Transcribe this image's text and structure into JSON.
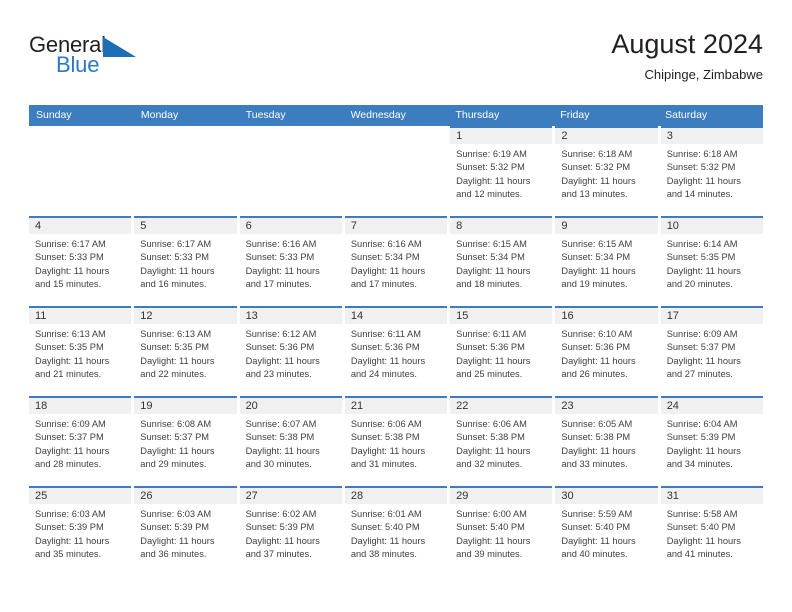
{
  "brand": {
    "line1": "General",
    "line2": "Blue",
    "flag_icon": "triangle-flag-icon",
    "color_dark": "#231f20",
    "color_blue": "#2b7ac4"
  },
  "header": {
    "title": "August 2024",
    "subtitle": "Chipinge, Zimbabwe"
  },
  "theme": {
    "header_blue": "#3c7dbf",
    "daynum_band": "#f0f0f0",
    "text": "#3f3f3f"
  },
  "calendar": {
    "day_names": [
      "Sunday",
      "Monday",
      "Tuesday",
      "Wednesday",
      "Thursday",
      "Friday",
      "Saturday"
    ],
    "weeks": [
      [
        {
          "day": "",
          "lines": []
        },
        {
          "day": "",
          "lines": []
        },
        {
          "day": "",
          "lines": []
        },
        {
          "day": "",
          "lines": []
        },
        {
          "day": "1",
          "lines": [
            "Sunrise: 6:19 AM",
            "Sunset: 5:32 PM",
            "Daylight: 11 hours",
            "and 12 minutes."
          ]
        },
        {
          "day": "2",
          "lines": [
            "Sunrise: 6:18 AM",
            "Sunset: 5:32 PM",
            "Daylight: 11 hours",
            "and 13 minutes."
          ]
        },
        {
          "day": "3",
          "lines": [
            "Sunrise: 6:18 AM",
            "Sunset: 5:32 PM",
            "Daylight: 11 hours",
            "and 14 minutes."
          ]
        }
      ],
      [
        {
          "day": "4",
          "lines": [
            "Sunrise: 6:17 AM",
            "Sunset: 5:33 PM",
            "Daylight: 11 hours",
            "and 15 minutes."
          ]
        },
        {
          "day": "5",
          "lines": [
            "Sunrise: 6:17 AM",
            "Sunset: 5:33 PM",
            "Daylight: 11 hours",
            "and 16 minutes."
          ]
        },
        {
          "day": "6",
          "lines": [
            "Sunrise: 6:16 AM",
            "Sunset: 5:33 PM",
            "Daylight: 11 hours",
            "and 17 minutes."
          ]
        },
        {
          "day": "7",
          "lines": [
            "Sunrise: 6:16 AM",
            "Sunset: 5:34 PM",
            "Daylight: 11 hours",
            "and 17 minutes."
          ]
        },
        {
          "day": "8",
          "lines": [
            "Sunrise: 6:15 AM",
            "Sunset: 5:34 PM",
            "Daylight: 11 hours",
            "and 18 minutes."
          ]
        },
        {
          "day": "9",
          "lines": [
            "Sunrise: 6:15 AM",
            "Sunset: 5:34 PM",
            "Daylight: 11 hours",
            "and 19 minutes."
          ]
        },
        {
          "day": "10",
          "lines": [
            "Sunrise: 6:14 AM",
            "Sunset: 5:35 PM",
            "Daylight: 11 hours",
            "and 20 minutes."
          ]
        }
      ],
      [
        {
          "day": "11",
          "lines": [
            "Sunrise: 6:13 AM",
            "Sunset: 5:35 PM",
            "Daylight: 11 hours",
            "and 21 minutes."
          ]
        },
        {
          "day": "12",
          "lines": [
            "Sunrise: 6:13 AM",
            "Sunset: 5:35 PM",
            "Daylight: 11 hours",
            "and 22 minutes."
          ]
        },
        {
          "day": "13",
          "lines": [
            "Sunrise: 6:12 AM",
            "Sunset: 5:36 PM",
            "Daylight: 11 hours",
            "and 23 minutes."
          ]
        },
        {
          "day": "14",
          "lines": [
            "Sunrise: 6:11 AM",
            "Sunset: 5:36 PM",
            "Daylight: 11 hours",
            "and 24 minutes."
          ]
        },
        {
          "day": "15",
          "lines": [
            "Sunrise: 6:11 AM",
            "Sunset: 5:36 PM",
            "Daylight: 11 hours",
            "and 25 minutes."
          ]
        },
        {
          "day": "16",
          "lines": [
            "Sunrise: 6:10 AM",
            "Sunset: 5:36 PM",
            "Daylight: 11 hours",
            "and 26 minutes."
          ]
        },
        {
          "day": "17",
          "lines": [
            "Sunrise: 6:09 AM",
            "Sunset: 5:37 PM",
            "Daylight: 11 hours",
            "and 27 minutes."
          ]
        }
      ],
      [
        {
          "day": "18",
          "lines": [
            "Sunrise: 6:09 AM",
            "Sunset: 5:37 PM",
            "Daylight: 11 hours",
            "and 28 minutes."
          ]
        },
        {
          "day": "19",
          "lines": [
            "Sunrise: 6:08 AM",
            "Sunset: 5:37 PM",
            "Daylight: 11 hours",
            "and 29 minutes."
          ]
        },
        {
          "day": "20",
          "lines": [
            "Sunrise: 6:07 AM",
            "Sunset: 5:38 PM",
            "Daylight: 11 hours",
            "and 30 minutes."
          ]
        },
        {
          "day": "21",
          "lines": [
            "Sunrise: 6:06 AM",
            "Sunset: 5:38 PM",
            "Daylight: 11 hours",
            "and 31 minutes."
          ]
        },
        {
          "day": "22",
          "lines": [
            "Sunrise: 6:06 AM",
            "Sunset: 5:38 PM",
            "Daylight: 11 hours",
            "and 32 minutes."
          ]
        },
        {
          "day": "23",
          "lines": [
            "Sunrise: 6:05 AM",
            "Sunset: 5:38 PM",
            "Daylight: 11 hours",
            "and 33 minutes."
          ]
        },
        {
          "day": "24",
          "lines": [
            "Sunrise: 6:04 AM",
            "Sunset: 5:39 PM",
            "Daylight: 11 hours",
            "and 34 minutes."
          ]
        }
      ],
      [
        {
          "day": "25",
          "lines": [
            "Sunrise: 6:03 AM",
            "Sunset: 5:39 PM",
            "Daylight: 11 hours",
            "and 35 minutes."
          ]
        },
        {
          "day": "26",
          "lines": [
            "Sunrise: 6:03 AM",
            "Sunset: 5:39 PM",
            "Daylight: 11 hours",
            "and 36 minutes."
          ]
        },
        {
          "day": "27",
          "lines": [
            "Sunrise: 6:02 AM",
            "Sunset: 5:39 PM",
            "Daylight: 11 hours",
            "and 37 minutes."
          ]
        },
        {
          "day": "28",
          "lines": [
            "Sunrise: 6:01 AM",
            "Sunset: 5:40 PM",
            "Daylight: 11 hours",
            "and 38 minutes."
          ]
        },
        {
          "day": "29",
          "lines": [
            "Sunrise: 6:00 AM",
            "Sunset: 5:40 PM",
            "Daylight: 11 hours",
            "and 39 minutes."
          ]
        },
        {
          "day": "30",
          "lines": [
            "Sunrise: 5:59 AM",
            "Sunset: 5:40 PM",
            "Daylight: 11 hours",
            "and 40 minutes."
          ]
        },
        {
          "day": "31",
          "lines": [
            "Sunrise: 5:58 AM",
            "Sunset: 5:40 PM",
            "Daylight: 11 hours",
            "and 41 minutes."
          ]
        }
      ]
    ]
  }
}
